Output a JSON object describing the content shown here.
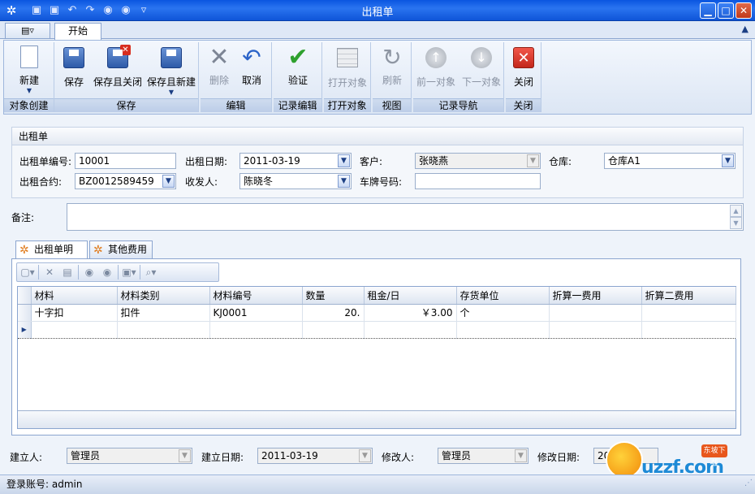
{
  "window": {
    "title": "出租单",
    "quick_access": [
      "save-icon",
      "save-close-icon",
      "undo-icon",
      "redo-icon",
      "up-icon",
      "down-icon",
      "customize-icon"
    ]
  },
  "ribbon": {
    "menu_button": "▤▿",
    "tabs": [
      "开始"
    ],
    "groups": {
      "create": {
        "label": "对象创建",
        "new": "新建"
      },
      "save": {
        "label": "保存",
        "save": "保存",
        "save_close": "保存且关闭",
        "save_new": "保存且新建"
      },
      "edit": {
        "label": "编辑",
        "delete": "删除",
        "cancel": "取消"
      },
      "validate": {
        "label": "记录编辑",
        "validate": "验证"
      },
      "open": {
        "label": "打开对象",
        "open": "打开对象"
      },
      "view": {
        "label": "视图",
        "refresh": "刷新"
      },
      "nav": {
        "label": "记录导航",
        "prev": "前一对象",
        "next": "下一对象"
      },
      "close": {
        "label": "关闭",
        "close": "关闭"
      }
    }
  },
  "form": {
    "section_title": "出租单",
    "order_no_label": "出租单编号:",
    "order_no": "10001",
    "date_label": "出租日期:",
    "date": "2011-03-19",
    "customer_label": "客户:",
    "customer": "张晓燕",
    "warehouse_label": "仓库:",
    "warehouse": "仓库A1",
    "contract_label": "出租合约:",
    "contract": "BZ0012589459",
    "receiver_label": "收发人:",
    "receiver": "陈晓冬",
    "plate_label": "车牌号码:",
    "plate": "",
    "memo_label": "备注:",
    "memo": ""
  },
  "detail": {
    "tabs": [
      "出租单明细",
      "其他费用"
    ],
    "columns": [
      "材料",
      "材料类别",
      "材料编号",
      "数量",
      "租金/日",
      "存货单位",
      "折算一费用",
      "折算二费用"
    ],
    "rows": [
      [
        "十字扣",
        "扣件",
        "KJ0001",
        "20.",
        "￥3.00",
        "个",
        "",
        ""
      ]
    ]
  },
  "audit": {
    "creator_label": "建立人:",
    "creator": "管理员",
    "created_label": "建立日期:",
    "created": "2011-03-19",
    "modifier_label": "修改人:",
    "modifier": "管理员",
    "modified_label": "修改日期:",
    "modified": "201"
  },
  "status": {
    "login": "登录账号: admin"
  },
  "watermark": {
    "brand": "uzzf.com",
    "tag": "东坡下载"
  }
}
